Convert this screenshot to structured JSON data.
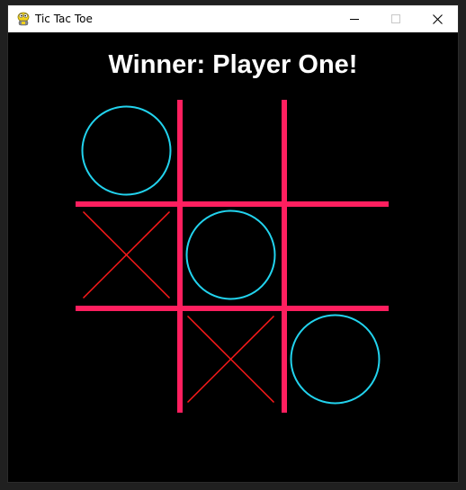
{
  "window": {
    "title": "Tic Tac Toe",
    "icon": "python-snake-icon",
    "buttons": [
      "minimize",
      "maximize",
      "close"
    ]
  },
  "game": {
    "status": "Winner: Player One!",
    "board": [
      [
        "O",
        "",
        ""
      ],
      [
        "X",
        "O",
        ""
      ],
      [
        "",
        "X",
        "O"
      ]
    ],
    "colors": {
      "background": "#000000",
      "grid": "#ff1f5f",
      "o_mark": "#22d3ee",
      "x_mark": "#ff1a1a",
      "status_text": "#ffffff"
    }
  }
}
